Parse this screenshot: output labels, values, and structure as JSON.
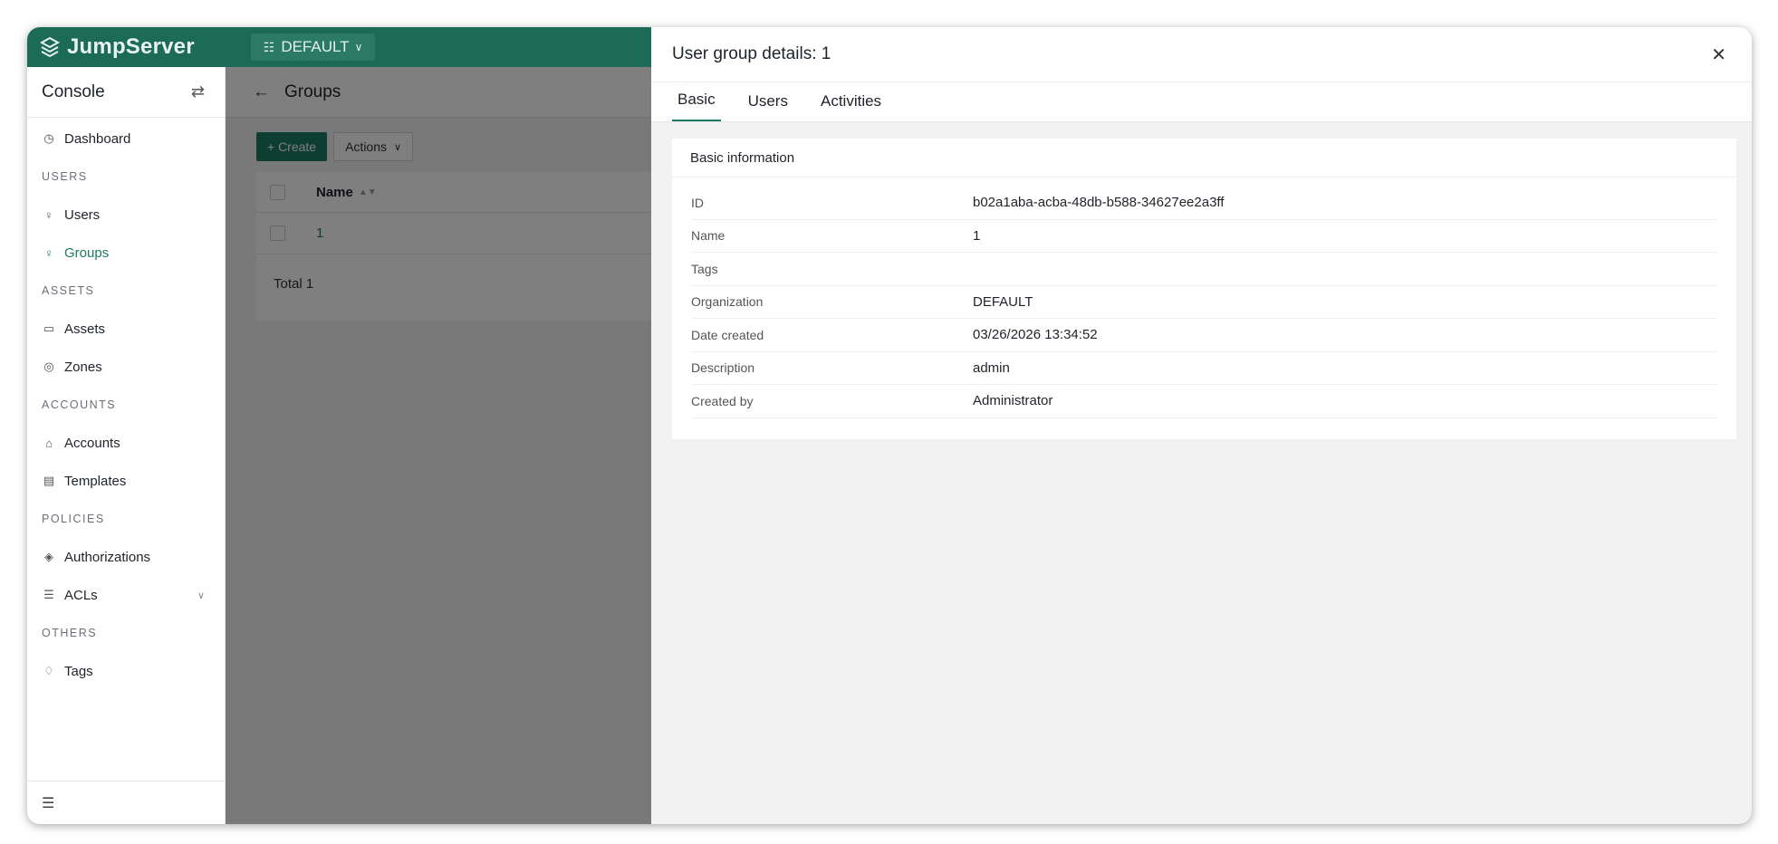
{
  "brand": {
    "name": "JumpServer"
  },
  "org": {
    "name": "DEFAULT"
  },
  "sidebar": {
    "title": "Console",
    "items": {
      "dashboard": "Dashboard",
      "users_section": "USERS",
      "users": "Users",
      "groups": "Groups",
      "assets_section": "ASSETS",
      "assets": "Assets",
      "zones": "Zones",
      "accounts_section": "ACCOUNTS",
      "accounts": "Accounts",
      "templates": "Templates",
      "policies_section": "POLICIES",
      "authorizations": "Authorizations",
      "acls": "ACLs",
      "others_section": "OTHERS",
      "tags": "Tags"
    }
  },
  "page": {
    "title": "Groups"
  },
  "toolbar": {
    "create_label": "+ Create",
    "actions_label": "Actions"
  },
  "table": {
    "columns": [
      "Name"
    ],
    "rows": [
      {
        "name": "1"
      }
    ],
    "total": "Total 1"
  },
  "drawer": {
    "title": "User group details: 1",
    "tabs": [
      "Basic",
      "Users",
      "Activities"
    ],
    "card_title": "Basic information",
    "fields": [
      {
        "key": "ID",
        "value": "b02a1aba-acba-48db-b588-34627ee2a3ff"
      },
      {
        "key": "Name",
        "value": "1"
      },
      {
        "key": "Tags",
        "value": ""
      },
      {
        "key": "Organization",
        "value": "DEFAULT"
      },
      {
        "key": "Date created",
        "value": "03/26/2026 13:34:52"
      },
      {
        "key": "Description",
        "value": "admin"
      },
      {
        "key": "Created by",
        "value": "Administrator"
      }
    ]
  },
  "colors": {
    "brand_green": "#1c6b57",
    "accent_green": "#1c7a62",
    "overlay": "rgba(0,0,0,0.5)"
  },
  "icons": {
    "logo": "jumpserver-logo-icon",
    "org": "org-tree-icon",
    "switch": "swap-arrows-icon",
    "back": "arrow-left-icon",
    "close": "close-icon",
    "menu_toggle": "menu-collapse-icon"
  }
}
